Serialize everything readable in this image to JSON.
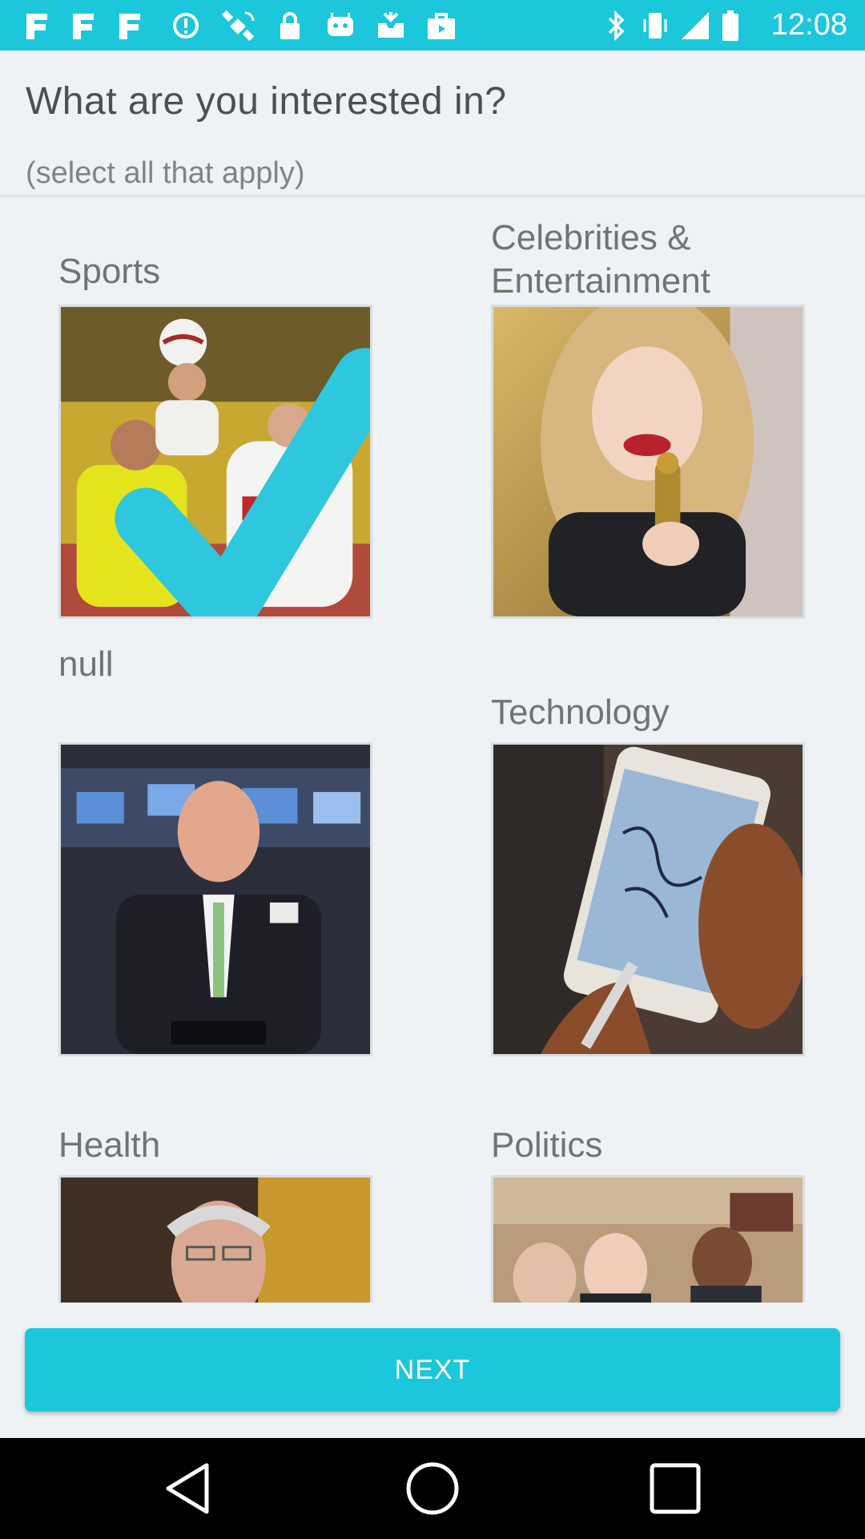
{
  "status_bar": {
    "time": "12:08",
    "left_icons": [
      "facebook-icon",
      "facebook-icon",
      "facebook-icon",
      "data-saver-icon",
      "satellite-icon",
      "lock-icon",
      "android-icon",
      "inbox-icon",
      "briefcase-icon"
    ],
    "right_icons": [
      "bluetooth-icon",
      "vibrate-icon",
      "signal-icon",
      "battery-icon"
    ]
  },
  "header": {
    "title": "What are you interested in?",
    "subtitle": "(select all that apply)"
  },
  "categories": [
    {
      "label": "Sports",
      "selected": true,
      "image": "soccer-players-image"
    },
    {
      "label": "Celebrities & Entertainment",
      "selected": false,
      "image": "celebrity-with-award-image"
    },
    {
      "label": "null",
      "selected": false,
      "image": "stock-trader-image"
    },
    {
      "label": "Technology",
      "selected": false,
      "image": "smartphone-stylus-image"
    },
    {
      "label": "Health",
      "selected": false,
      "image": "elderly-man-image"
    },
    {
      "label": "Politics",
      "selected": false,
      "image": "politicians-image"
    }
  ],
  "next_button": {
    "label": "NEXT"
  },
  "colors": {
    "accent": "#1cc7dc",
    "background": "#eef2f5",
    "checkmark": "#2ec7dd"
  },
  "nav_bar": {
    "buttons": [
      "back-icon",
      "home-icon",
      "recents-icon"
    ]
  }
}
